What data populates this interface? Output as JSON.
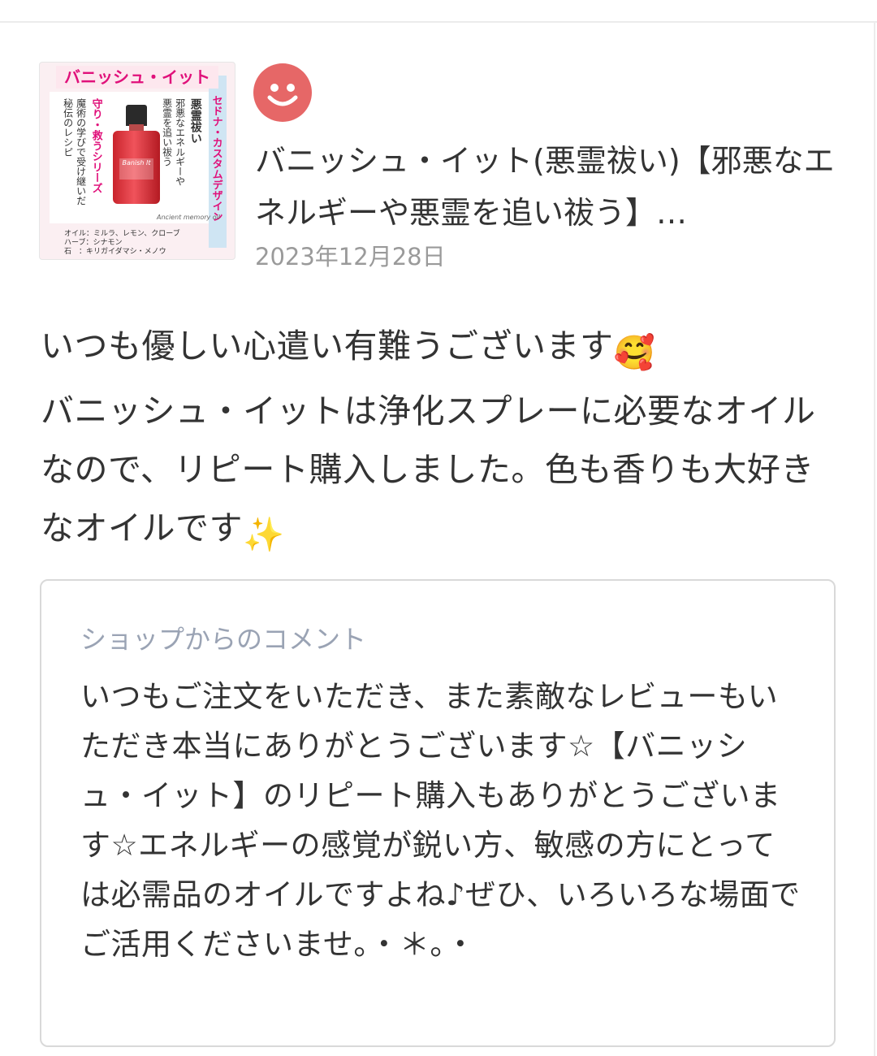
{
  "product": {
    "title": "バニッシュ・イット(悪霊祓い)【邪悪なエネルギーや悪霊を追い祓う】…",
    "date": "2023年12月28日",
    "thumbnail": {
      "banner": "バニッシュ・イット",
      "design_label": "セドナ・カスタムデザイン",
      "name_vertical": "悪霊祓い",
      "desc_line1": "邪悪なエネルギーや",
      "desc_line2": "悪霊を追い祓う",
      "series": "守り・救うシリーズ",
      "desc_line3": "魔術の学びで受け継いだ",
      "desc_line4": "秘伝のレシピ",
      "bottle_label": "Banish It",
      "signature": "Ancient memory oil",
      "ingredients_oil": "オイル：ミルラ、レモン、クローブ",
      "ingredients_herb": "ハーブ：シナモン",
      "ingredients_stone": "石　：キリガイダマシ・メノウ"
    }
  },
  "reviewer": {
    "avatar_icon": "smiley-face-icon",
    "avatar_color": "#e66767"
  },
  "review": {
    "text": "いつも優しい心遣い有難うございます",
    "emoji1": "🥰",
    "text2": "バニッシュ・イットは浄化スプレーに必要なオイルなので、リピート購入しました。色も香りも大好きなオイルです",
    "emoji2": "✨"
  },
  "shop_comment": {
    "label": "ショップからのコメント",
    "text": "いつもご注文をいただき、また素敵なレビューもいただき本当にありがとうございます☆【バニッシュ・イット】のリピート購入もありがとうございます☆エネルギーの感覚が鋭い方、敏感の方にとっては必需品のオイルですよね♪ぜひ、いろいろな場面でご活用くださいませ。・＊。・"
  }
}
